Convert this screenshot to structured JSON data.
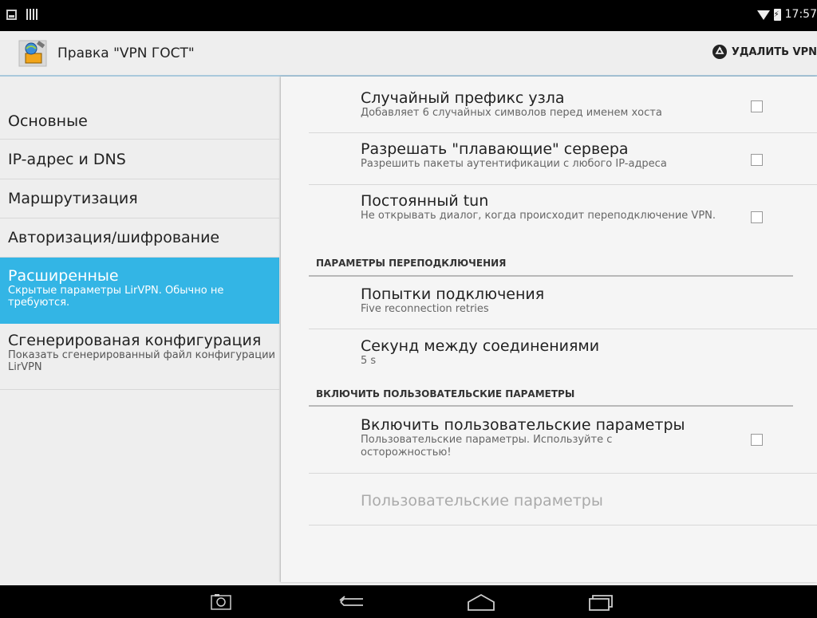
{
  "status_bar": {
    "time": "17:57",
    "left_icons": [
      "gallery-icon",
      "barcode-icon"
    ],
    "right_icons": [
      "wifi-icon",
      "battery-charging-icon"
    ]
  },
  "action_bar": {
    "title": "Правка \"VPN ГОСТ\"",
    "delete_label": "УДАЛИТЬ VPN",
    "app_icon": "vpn-app-icon",
    "delete_icon": "recycle-icon"
  },
  "nav": {
    "items": [
      {
        "label": "Основные"
      },
      {
        "label": "IP-адрес и DNS"
      },
      {
        "label": "Маршрутизация"
      },
      {
        "label": "Авторизация/шифрование"
      },
      {
        "label": "Расширенные",
        "summary": "Скрытые параметры LirVPN. Обычно не требуются.",
        "selected": true
      },
      {
        "label": "Сгенерированая конфигурация",
        "summary": "Показать сгенерированный файл конфигурации LirVPN"
      }
    ]
  },
  "prefs": {
    "random_host": {
      "title": "Случайный префикс узла",
      "summary": "Добавляет 6 случайных символов перед именем хоста",
      "checked": false
    },
    "float": {
      "title": "Разрешать \"плавающие\" сервера",
      "summary": "Разрешить пакеты аутентификации с любого IP-адреса",
      "checked": false
    },
    "persist_tun": {
      "title": "Постоянный tun",
      "summary": "Не открывать диалог, когда происходит переподключение VPN.",
      "checked": false
    },
    "reconnect_header": "ПАРАМЕТРЫ ПЕРЕПОДКЛЮЧЕНИЯ",
    "retries": {
      "title": "Попытки подключения",
      "summary": "Five reconnection retries"
    },
    "seconds": {
      "title": "Секунд между соединениями",
      "summary": "5 s"
    },
    "custom_header": "ВКЛЮЧИТЬ ПОЛЬЗОВАТЕЛЬСКИЕ ПАРАМЕТРЫ",
    "custom_enable": {
      "title": "Включить пользовательские параметры",
      "summary": "Пользовательские параметры. Используйте с осторожностью!",
      "checked": false
    },
    "custom_options": {
      "title": "Пользовательские параметры",
      "enabled": false
    }
  },
  "nav_bar": {
    "buttons": [
      "screenshot-icon",
      "back-icon",
      "home-icon",
      "recents-icon"
    ]
  },
  "colors": {
    "accent": "#33b5e5",
    "background": "#eeeeee",
    "pane": "#f5f5f5"
  }
}
